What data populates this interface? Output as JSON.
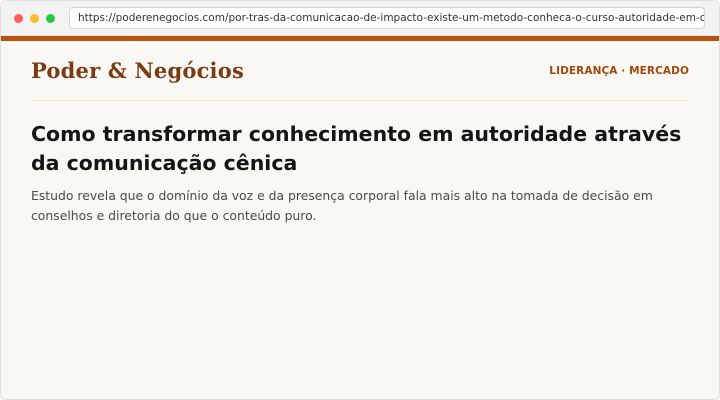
{
  "colors": {
    "accent": "#b5540f",
    "brand_text": "#7a3b12",
    "section_text": "#a1480f",
    "dot_close": "#fe5f57",
    "dot_minimize": "#febc2e",
    "dot_maximize": "#28c840"
  },
  "browser": {
    "url": "https://poderenegocios.com/por-tras-da-comunicacao-de-impacto-existe-um-metodo-conheca-o-curso-autoridade-em-cena/"
  },
  "site": {
    "logo": "Poder & Negócios",
    "section": "LIDERANÇA · MERCADO"
  },
  "article": {
    "headline": "Como transformar conhecimento em autoridade através da comunicação cênica",
    "subhead": "Estudo revela que o domínio da voz e da presença corporal fala mais alto na tomada de decisão em conselhos e diretoria do que o conteúdo puro."
  }
}
